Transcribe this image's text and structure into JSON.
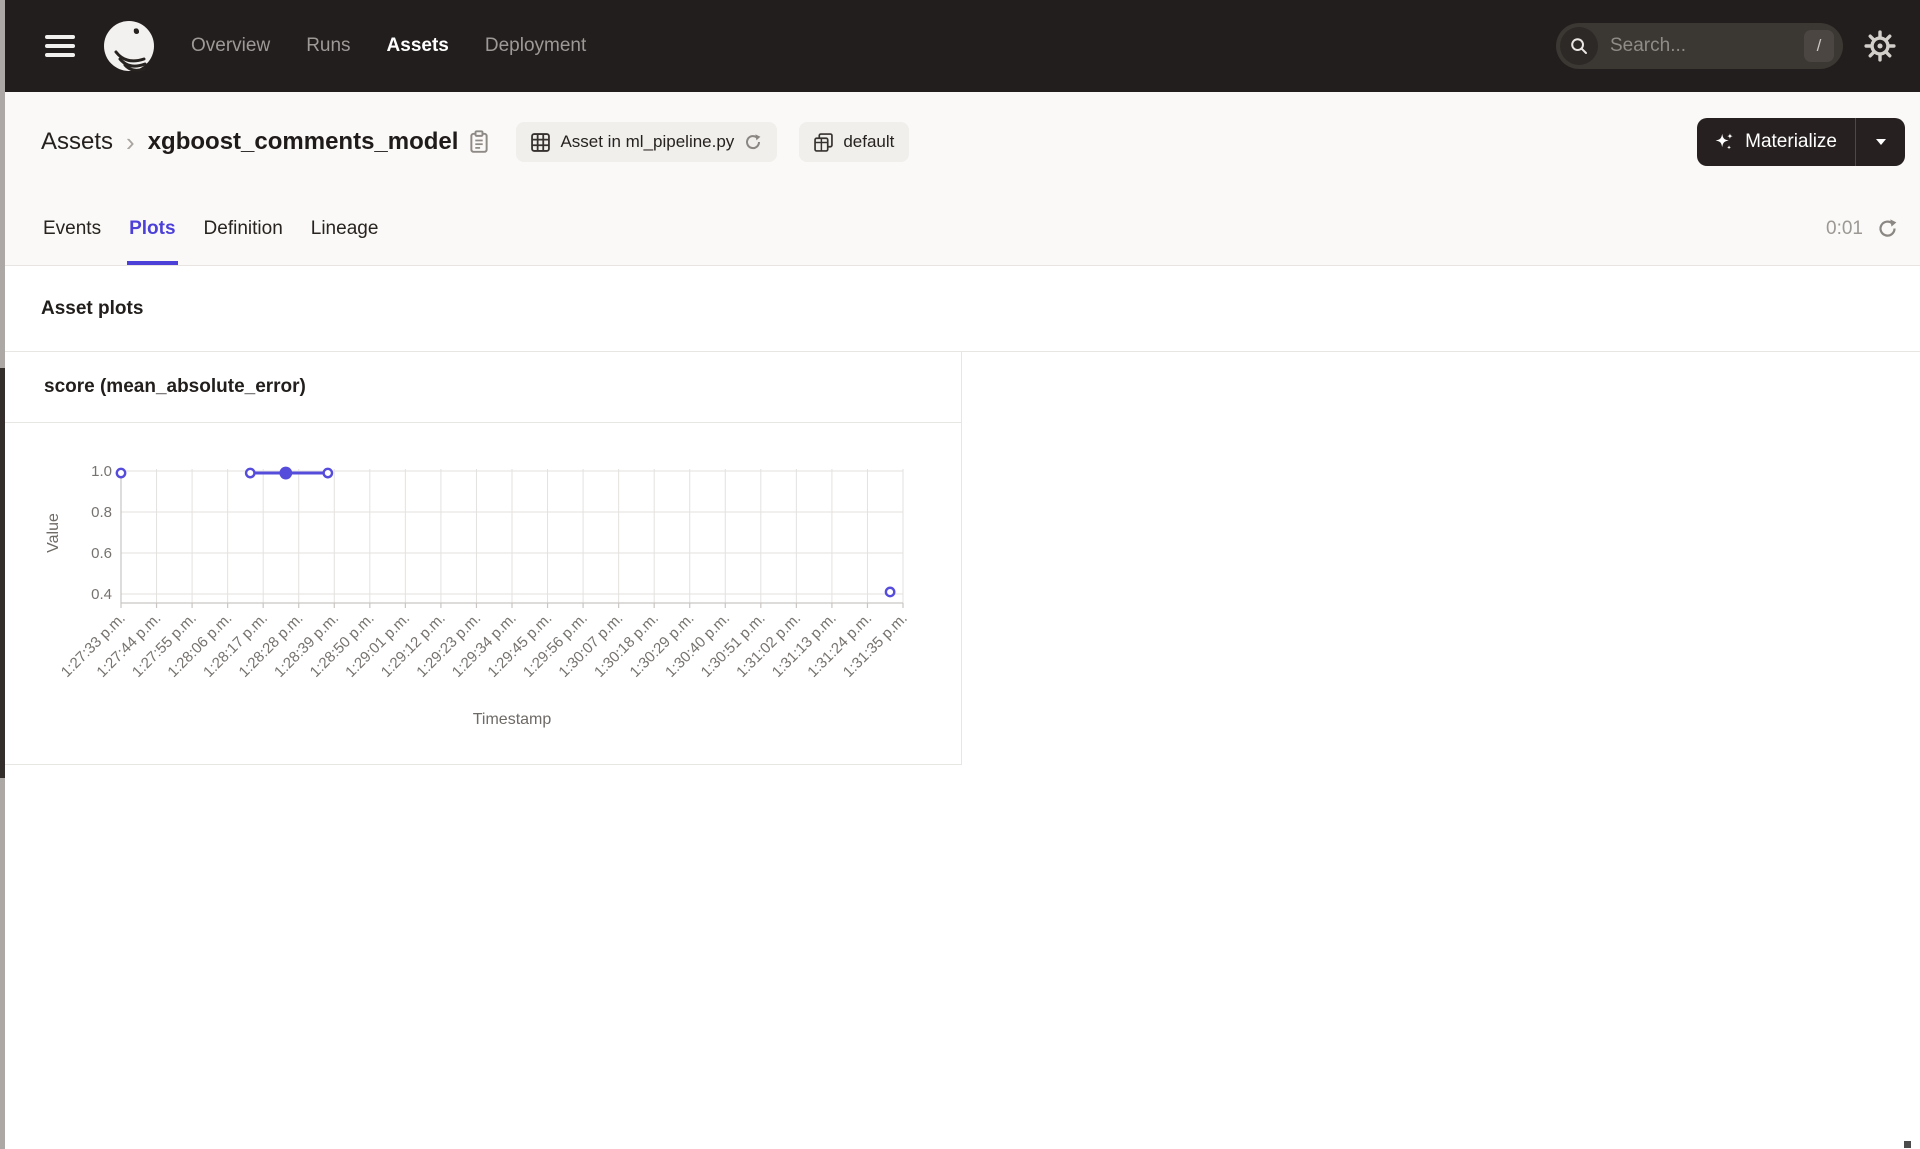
{
  "navbar": {
    "items": [
      {
        "label": "Overview",
        "active": false
      },
      {
        "label": "Runs",
        "active": false
      },
      {
        "label": "Assets",
        "active": true
      },
      {
        "label": "Deployment",
        "active": false
      }
    ],
    "search": {
      "placeholder": "Search...",
      "shortcut": "/"
    }
  },
  "header": {
    "breadcrumb": {
      "root": "Assets",
      "separator": "›",
      "current": "xgboost_comments_model"
    },
    "chips": [
      {
        "label": "Asset in ml_pipeline.py"
      },
      {
        "label": "default"
      }
    ],
    "materialize": {
      "label": "Materialize"
    }
  },
  "tabs": {
    "items": [
      {
        "label": "Events",
        "active": false
      },
      {
        "label": "Plots",
        "active": true
      },
      {
        "label": "Definition",
        "active": false
      },
      {
        "label": "Lineage",
        "active": false
      }
    ],
    "timer": "0:01"
  },
  "section": {
    "title": "Asset plots"
  },
  "card": {
    "title": "score (mean_absolute_error)"
  },
  "chart_data": {
    "type": "line",
    "title": "score (mean_absolute_error)",
    "xlabel": "Timestamp",
    "ylabel": "Value",
    "yticks": [
      1.0,
      0.8,
      0.6,
      0.4
    ],
    "ylim": [
      0.36,
      1.03
    ],
    "grid": true,
    "legend": false,
    "x_tick_interval_seconds": 11,
    "x_tick_labels": [
      "1:27:33 p.m.",
      "1:27:44 p.m.",
      "1:27:55 p.m.",
      "1:28:06 p.m.",
      "1:28:17 p.m.",
      "1:28:28 p.m.",
      "1:28:39 p.m.",
      "1:28:50 p.m.",
      "1:29:01 p.m.",
      "1:29:12 p.m.",
      "1:29:23 p.m.",
      "1:29:34 p.m.",
      "1:29:45 p.m.",
      "1:29:56 p.m.",
      "1:30:07 p.m.",
      "1:30:18 p.m.",
      "1:30:29 p.m.",
      "1:30:40 p.m.",
      "1:30:51 p.m.",
      "1:31:02 p.m.",
      "1:31:13 p.m.",
      "1:31:24 p.m.",
      "1:31:35 p.m."
    ],
    "series": [
      {
        "name": "score (mean_absolute_error)",
        "points": [
          {
            "x_seconds": 0,
            "approx_time": "1:27:33 p.m.",
            "value": 0.99,
            "marker": "hollow"
          },
          {
            "x_seconds": 40,
            "approx_time": "~1:28:13 p.m.",
            "value": 0.99,
            "marker": "hollow"
          },
          {
            "x_seconds": 51,
            "approx_time": "~1:28:24 p.m.",
            "value": 0.99,
            "marker": "filled"
          },
          {
            "x_seconds": 64,
            "approx_time": "~1:28:37 p.m.",
            "value": 0.99,
            "marker": "hollow"
          },
          {
            "x_seconds": 238,
            "approx_time": "~1:31:31 p.m.",
            "value": 0.41,
            "marker": "hollow"
          }
        ],
        "connected_segment": [
          1,
          2,
          3
        ]
      }
    ],
    "colors": {
      "line": "#564CDC",
      "grid": "#E4E2DF",
      "axis": "#C9C6C3",
      "tick_text": "#76726E",
      "axis_title": "#6E6A66"
    }
  }
}
